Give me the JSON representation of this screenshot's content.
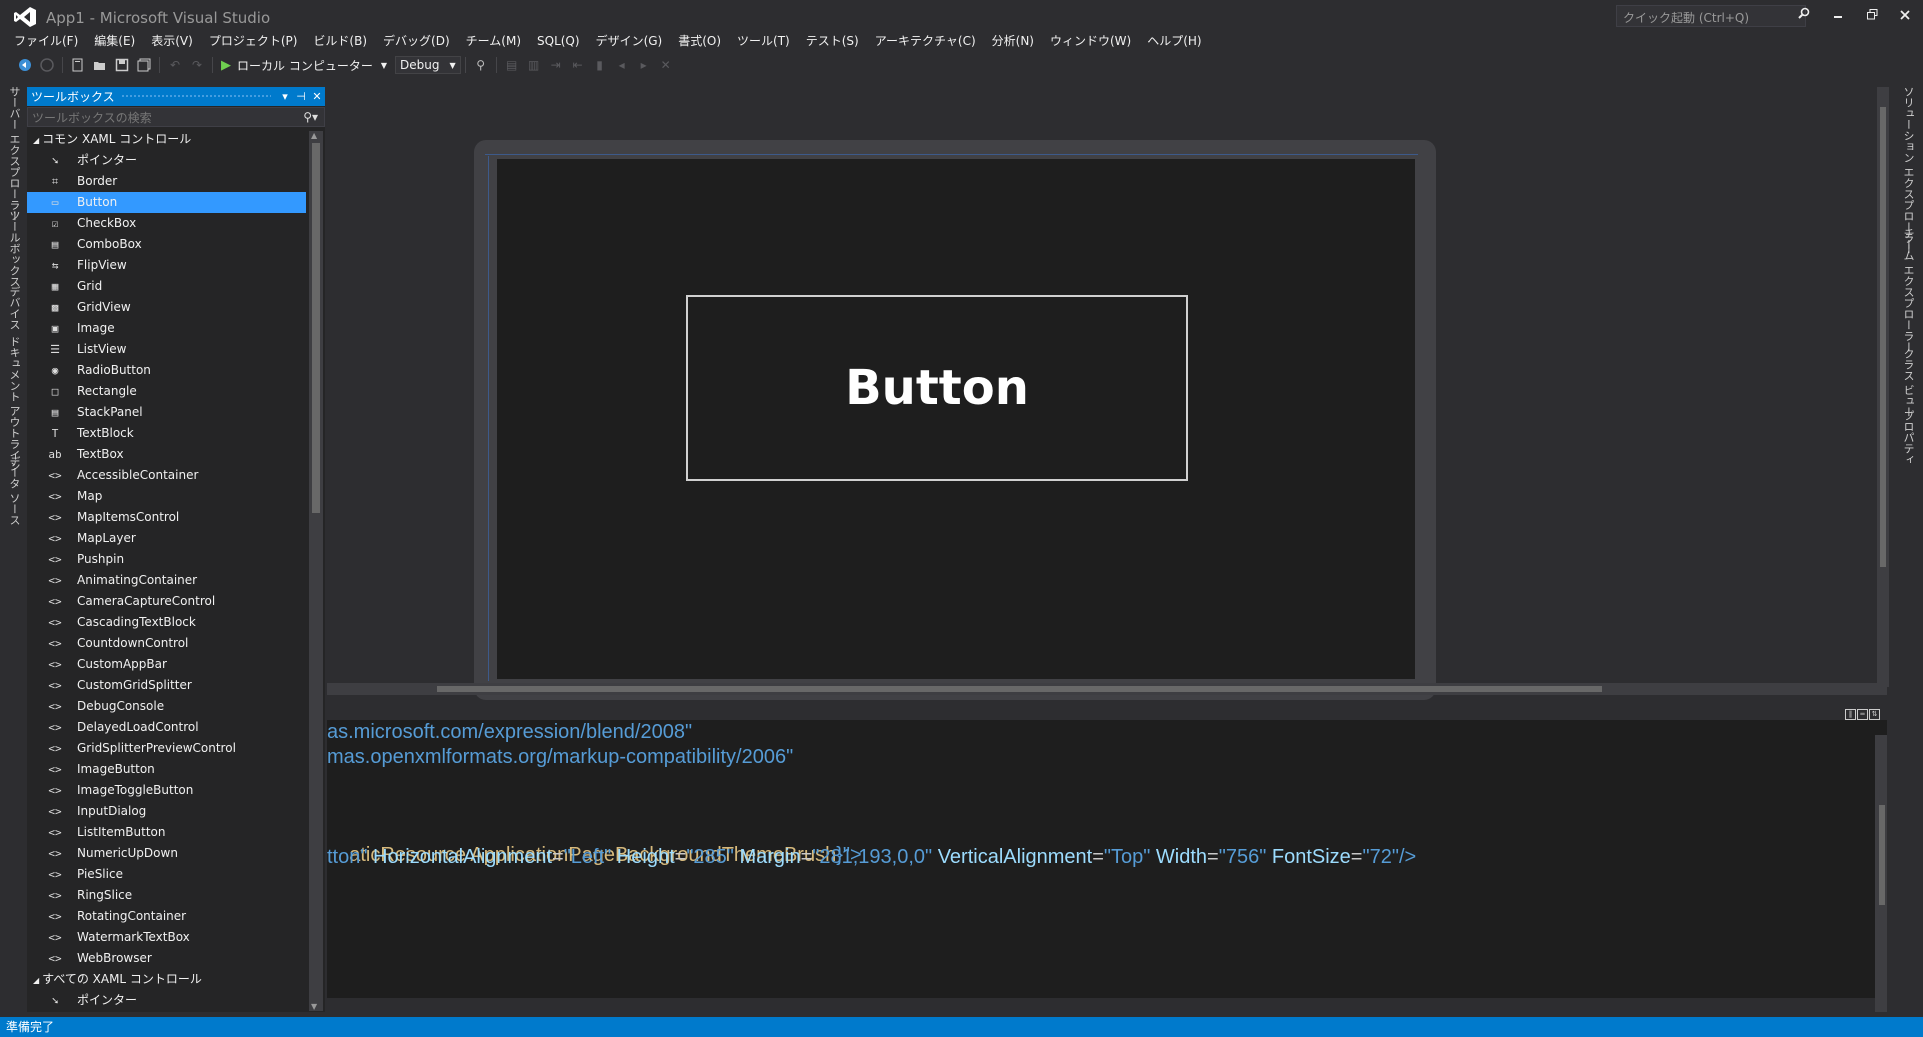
{
  "window": {
    "title": "App1 - Microsoft Visual Studio",
    "quick_launch_placeholder": "クイック起動 (Ctrl+Q)"
  },
  "menu": [
    "ファイル(F)",
    "編集(E)",
    "表示(V)",
    "プロジェクト(P)",
    "ビルド(B)",
    "デバッグ(D)",
    "チーム(M)",
    "SQL(Q)",
    "デザイン(G)",
    "書式(O)",
    "ツール(T)",
    "テスト(S)",
    "アーキテクチャ(C)",
    "分析(N)",
    "ウィンドウ(W)",
    "ヘルプ(H)"
  ],
  "toolbar": {
    "run_target": "ローカル コンピューター",
    "config": "Debug"
  },
  "left_tabs": [
    "サーバー エクスプローラー",
    "ツールボックス",
    "デバイス",
    "ドキュメント アウトライン",
    "データ ソース"
  ],
  "right_tabs": [
    "ソリューション エクスプローラー",
    "チーム エクスプローラー",
    "クラス ビュー",
    "プロパティ"
  ],
  "toolbox": {
    "title": "ツールボックス",
    "search_placeholder": "ツールボックスの検索",
    "group_common": "コモン XAML コントロール",
    "common_items": [
      {
        "label": "ポインター",
        "icon": "pointer-icon",
        "glyph": "➘"
      },
      {
        "label": "Border",
        "icon": "border-icon",
        "glyph": "⌗"
      },
      {
        "label": "Button",
        "icon": "button-icon",
        "glyph": "▭",
        "selected": true
      },
      {
        "label": "CheckBox",
        "icon": "checkbox-icon",
        "glyph": "☑"
      },
      {
        "label": "ComboBox",
        "icon": "combobox-icon",
        "glyph": "▤"
      },
      {
        "label": "FlipView",
        "icon": "flipview-icon",
        "glyph": "⇆"
      },
      {
        "label": "Grid",
        "icon": "grid-icon",
        "glyph": "▦"
      },
      {
        "label": "GridView",
        "icon": "gridview-icon",
        "glyph": "▩"
      },
      {
        "label": "Image",
        "icon": "image-icon",
        "glyph": "▣"
      },
      {
        "label": "ListView",
        "icon": "listview-icon",
        "glyph": "☰"
      },
      {
        "label": "RadioButton",
        "icon": "radiobutton-icon",
        "glyph": "◉"
      },
      {
        "label": "Rectangle",
        "icon": "rectangle-icon",
        "glyph": "□"
      },
      {
        "label": "StackPanel",
        "icon": "stackpanel-icon",
        "glyph": "▤"
      },
      {
        "label": "TextBlock",
        "icon": "textblock-icon",
        "glyph": "T"
      },
      {
        "label": "TextBox",
        "icon": "textbox-icon",
        "glyph": "ab"
      },
      {
        "label": "AccessibleContainer",
        "icon": "custom-control-icon",
        "glyph": "<>"
      },
      {
        "label": "Map",
        "icon": "custom-control-icon",
        "glyph": "<>"
      },
      {
        "label": "MapItemsControl",
        "icon": "custom-control-icon",
        "glyph": "<>"
      },
      {
        "label": "MapLayer",
        "icon": "custom-control-icon",
        "glyph": "<>"
      },
      {
        "label": "Pushpin",
        "icon": "custom-control-icon",
        "glyph": "<>"
      },
      {
        "label": "AnimatingContainer",
        "icon": "custom-control-icon",
        "glyph": "<>"
      },
      {
        "label": "CameraCaptureControl",
        "icon": "custom-control-icon",
        "glyph": "<>"
      },
      {
        "label": "CascadingTextBlock",
        "icon": "custom-control-icon",
        "glyph": "<>"
      },
      {
        "label": "CountdownControl",
        "icon": "custom-control-icon",
        "glyph": "<>"
      },
      {
        "label": "CustomAppBar",
        "icon": "custom-control-icon",
        "glyph": "<>"
      },
      {
        "label": "CustomGridSplitter",
        "icon": "custom-control-icon",
        "glyph": "<>"
      },
      {
        "label": "DebugConsole",
        "icon": "custom-control-icon",
        "glyph": "<>"
      },
      {
        "label": "DelayedLoadControl",
        "icon": "custom-control-icon",
        "glyph": "<>"
      },
      {
        "label": "GridSplitterPreviewControl",
        "icon": "custom-control-icon",
        "glyph": "<>"
      },
      {
        "label": "ImageButton",
        "icon": "custom-control-icon",
        "glyph": "<>"
      },
      {
        "label": "ImageToggleButton",
        "icon": "custom-control-icon",
        "glyph": "<>"
      },
      {
        "label": "InputDialog",
        "icon": "custom-control-icon",
        "glyph": "<>"
      },
      {
        "label": "ListItemButton",
        "icon": "custom-control-icon",
        "glyph": "<>"
      },
      {
        "label": "NumericUpDown",
        "icon": "custom-control-icon",
        "glyph": "<>"
      },
      {
        "label": "PieSlice",
        "icon": "custom-control-icon",
        "glyph": "<>"
      },
      {
        "label": "RingSlice",
        "icon": "custom-control-icon",
        "glyph": "<>"
      },
      {
        "label": "RotatingContainer",
        "icon": "custom-control-icon",
        "glyph": "<>"
      },
      {
        "label": "WatermarkTextBox",
        "icon": "custom-control-icon",
        "glyph": "<>"
      },
      {
        "label": "WebBrowser",
        "icon": "custom-control-icon",
        "glyph": "<>"
      }
    ],
    "group_all": "すべての XAML コントロール",
    "all_items": [
      {
        "label": "ポインター",
        "icon": "pointer-icon",
        "glyph": "➘"
      }
    ]
  },
  "designer": {
    "button_content": "Button"
  },
  "code": {
    "line1": "as.microsoft.com/expression/blend/2008\"",
    "line2": "mas.openxmlformats.org/markup-compatibility/2006\"",
    "line3_prefix": "aticResource ",
    "line3_resource": "ApplicationPageBackgroundThemeBrush",
    "line3_suffix": "}\">",
    "line4": [
      {
        "t": "tton\"",
        "c": "c-str"
      },
      {
        "t": " HorizontalAlignment",
        "c": "c-attr"
      },
      {
        "t": "=",
        "c": "c-txt"
      },
      {
        "t": "\"Left\"",
        "c": "c-str"
      },
      {
        "t": " Height",
        "c": "c-attr"
      },
      {
        "t": "=",
        "c": "c-txt"
      },
      {
        "t": "\"285\"",
        "c": "c-str"
      },
      {
        "t": " Margin",
        "c": "c-attr"
      },
      {
        "t": "=",
        "c": "c-txt"
      },
      {
        "t": "\"281,193,0,0\"",
        "c": "c-str"
      },
      {
        "t": " VerticalAlignment",
        "c": "c-attr"
      },
      {
        "t": "=",
        "c": "c-txt"
      },
      {
        "t": "\"Top\"",
        "c": "c-str"
      },
      {
        "t": " Width",
        "c": "c-attr"
      },
      {
        "t": "=",
        "c": "c-txt"
      },
      {
        "t": "\"756\"",
        "c": "c-str"
      },
      {
        "t": " FontSize",
        "c": "c-attr"
      },
      {
        "t": "=",
        "c": "c-txt"
      },
      {
        "t": "\"72\"",
        "c": "c-str"
      },
      {
        "t": "/>",
        "c": "c-blue"
      }
    ]
  },
  "status": {
    "text": "準備完了"
  },
  "colors": {
    "accent": "#007acc",
    "selection": "#3399ff",
    "background": "#2d2d30"
  }
}
